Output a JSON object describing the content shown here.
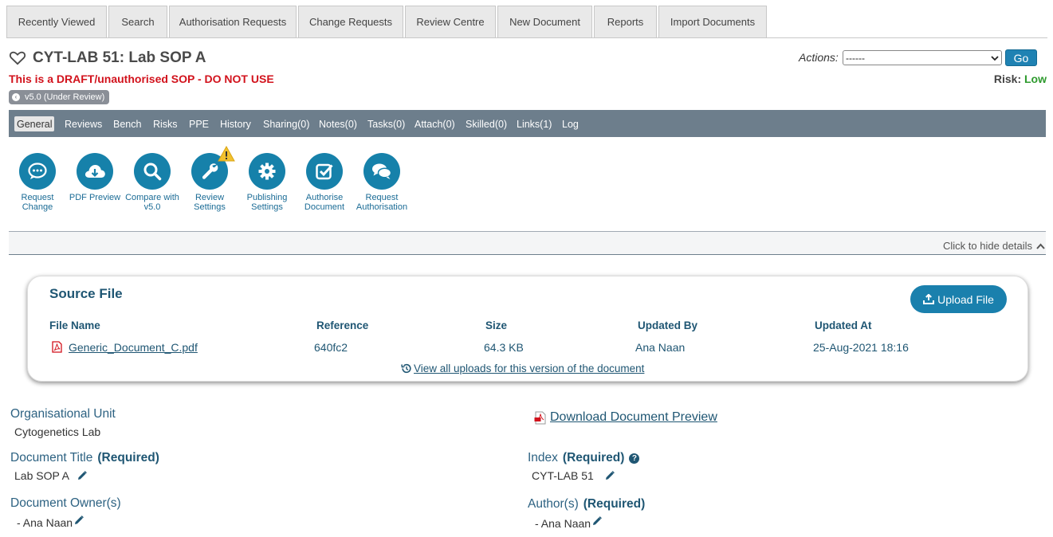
{
  "top_tabs": [
    "Recently Viewed",
    "Search",
    "Authorisation Requests",
    "Change Requests",
    "Review Centre",
    "New Document",
    "Reports",
    "Import Documents"
  ],
  "header": {
    "title": "CYT-LAB 51: Lab SOP A",
    "draft_warning": "This is a DRAFT/unauthorised SOP - DO NOT USE",
    "version_badge": "v5.0 (Under Review)",
    "actions_label": "Actions:",
    "actions_selected": "------",
    "go_label": "Go",
    "risk_label": "Risk:",
    "risk_value": "Low",
    "risk_color": "#2e9a2e",
    "warning_color": "#d2121c"
  },
  "subnav": [
    "General",
    "Reviews",
    "Bench",
    "Risks",
    "PPE",
    "History",
    "Sharing(0)",
    "Notes(0)",
    "Tasks(0)",
    "Attach(0)",
    "Skilled(0)",
    "Links(1)",
    "Log"
  ],
  "subnav_active": "General",
  "actions": [
    {
      "label1": "Request",
      "label2": "Change",
      "icon": "chat-bubble-icon"
    },
    {
      "label1": "PDF Preview",
      "label2": "",
      "icon": "cloud-download-icon"
    },
    {
      "label1": "Compare with",
      "label2": "v5.0",
      "icon": "search-icon"
    },
    {
      "label1": "Review",
      "label2": "Settings",
      "icon": "wrench-icon"
    },
    {
      "label1": "Publishing",
      "label2": "Settings",
      "icon": "gear-icon"
    },
    {
      "label1": "Authorise",
      "label2": "Document",
      "icon": "check-square-icon"
    },
    {
      "label1": "Request",
      "label2": "Authorisation",
      "icon": "chat-bubbles-icon"
    }
  ],
  "details_toggle": "Click to hide details",
  "source_file": {
    "title": "Source File",
    "upload_label": "Upload File",
    "columns": [
      "File Name",
      "Reference",
      "Size",
      "Updated By",
      "Updated At"
    ],
    "row": {
      "file_name": "Generic_Document_C.pdf",
      "reference": "640fc2",
      "size": "64.3 KB",
      "updated_by": "Ana Naan",
      "updated_at": "25-Aug-2021 18:16"
    },
    "view_all": "View all uploads for this version of the document"
  },
  "fields": {
    "org_unit_label": "Organisational Unit",
    "org_unit_value": "Cytogenetics Lab",
    "doc_title_label": "Document Title",
    "required": "(Required)",
    "doc_title_value": "Lab SOP A",
    "owner_label": "Document Owner(s)",
    "owner_value": "- Ana Naan",
    "download_preview": " Download Document Preview",
    "index_label": "Index",
    "index_value": "CYT-LAB 51",
    "author_label": "Author(s)",
    "author_value": "- Ana Naan"
  }
}
